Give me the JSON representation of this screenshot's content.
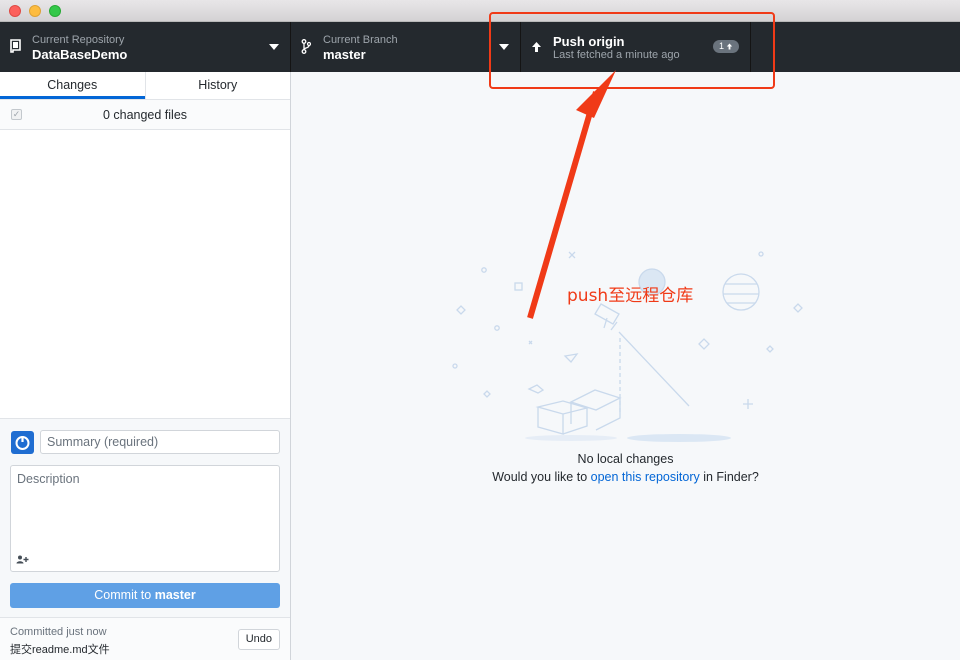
{
  "toolbar": {
    "repository": {
      "label": "Current Repository",
      "value": "DataBaseDemo"
    },
    "branch": {
      "label": "Current Branch",
      "value": "master"
    },
    "push": {
      "title": "Push origin",
      "subtitle": "Last fetched a minute ago",
      "badge_count": "1"
    }
  },
  "sidebar": {
    "tabs": [
      {
        "label": "Changes",
        "active": true
      },
      {
        "label": "History",
        "active": false
      }
    ],
    "changed_files": "0 changed files",
    "commit": {
      "summary_placeholder": "Summary (required)",
      "description_placeholder": "Description",
      "button_prefix": "Commit to ",
      "button_branch": "master"
    },
    "last_commit": {
      "time": "Committed just now",
      "message": "提交readme.md文件",
      "undo_label": "Undo"
    }
  },
  "main": {
    "title": "No local changes",
    "text_before": "Would you like to ",
    "link": "open this repository",
    "text_after": " in Finder?"
  },
  "annotation": {
    "text": "push至远程仓库",
    "color": "#f03a17"
  },
  "colors": {
    "toolbar_bg": "#24292e",
    "accent": "#0366d6",
    "commit_button": "#5fa0e5"
  }
}
